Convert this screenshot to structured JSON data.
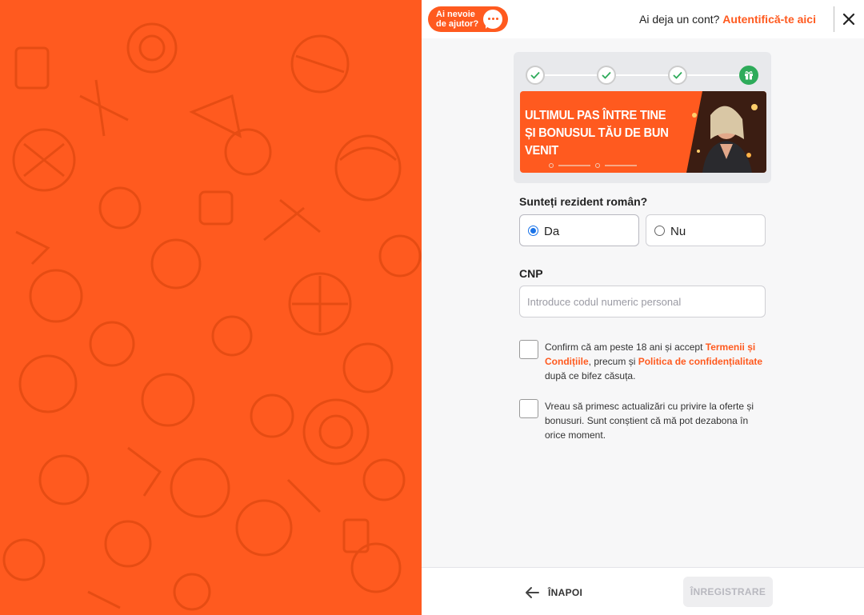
{
  "header": {
    "help_label": "Ai nevoie de ajutor?",
    "login_prompt": "Ai deja un cont?",
    "login_link": "Autentifică-te aici"
  },
  "banner": {
    "title": "Ultimul pas între tine și bonusul tău de bun venit"
  },
  "resident": {
    "question": "Sunteți rezident român?",
    "options": [
      {
        "label": "Da",
        "selected": true
      },
      {
        "label": "Nu",
        "selected": false
      }
    ]
  },
  "cnp": {
    "label": "CNP",
    "placeholder": "Introduce codul numeric personal",
    "value": ""
  },
  "consents": {
    "terms_prefix": "Confirm că am peste 18 ani și accept ",
    "terms_link": "Termenii și Condițiile",
    "terms_middle": ", precum și ",
    "privacy_link": "Politica de confidențialitate",
    "terms_suffix": " după ce bifez căsuța.",
    "marketing_text": "Vreau să primesc actualizări cu privire la oferte și bonusuri. Sunt conștient că mă pot dezabona în orice moment."
  },
  "footer": {
    "back_label": "ÎNAPOI",
    "register_label": "ÎNREGISTRARE"
  },
  "colors": {
    "brand": "#ff5a1f",
    "step_done": "#2eab5a"
  }
}
